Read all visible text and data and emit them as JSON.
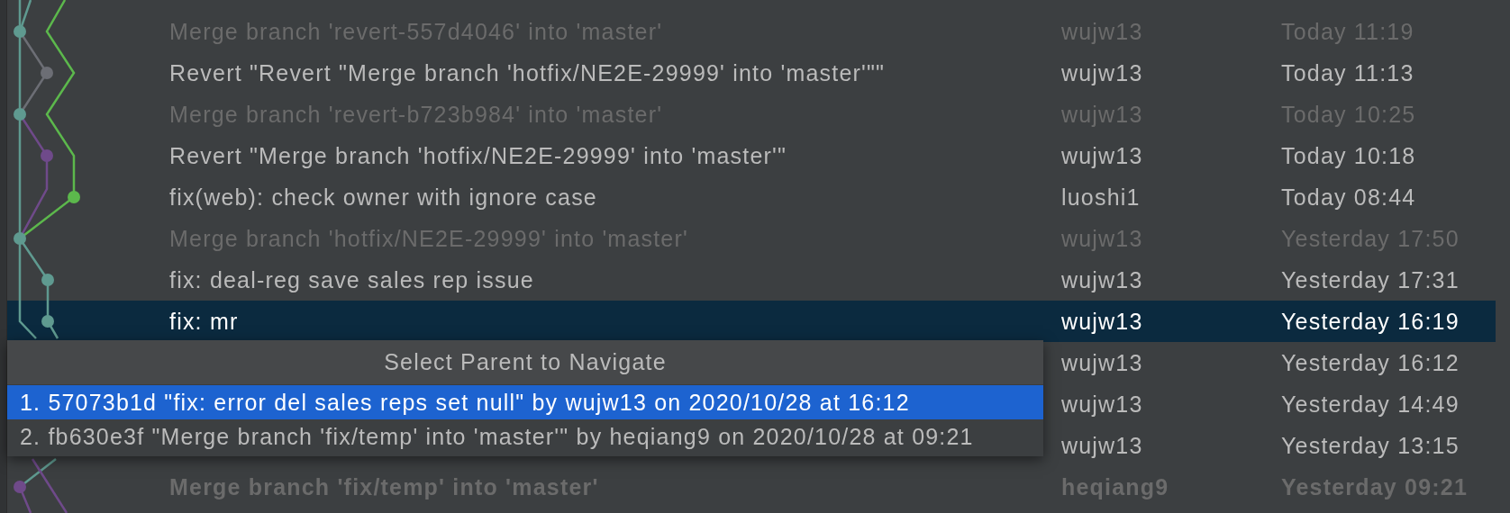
{
  "commits": [
    {
      "message": "Merge branch 'revert-557d4046' into 'master'",
      "author": "wujw13",
      "date": "Today 11:19",
      "dimmed": true,
      "bold": false,
      "selected": false
    },
    {
      "message": "Revert \"Revert \"Merge branch 'hotfix/NE2E-29999' into 'master'\"\"",
      "author": "wujw13",
      "date": "Today 11:13",
      "dimmed": false,
      "bold": false,
      "selected": false
    },
    {
      "message": "Merge branch 'revert-b723b984' into 'master'",
      "author": "wujw13",
      "date": "Today 10:25",
      "dimmed": true,
      "bold": false,
      "selected": false
    },
    {
      "message": "Revert \"Merge branch 'hotfix/NE2E-29999' into 'master'\"",
      "author": "wujw13",
      "date": "Today 10:18",
      "dimmed": false,
      "bold": false,
      "selected": false
    },
    {
      "message": "fix(web): check owner with ignore case",
      "author": "luoshi1",
      "date": "Today 08:44",
      "dimmed": false,
      "bold": false,
      "selected": false
    },
    {
      "message": "Merge branch 'hotfix/NE2E-29999' into 'master'",
      "author": "wujw13",
      "date": "Yesterday 17:50",
      "dimmed": true,
      "bold": false,
      "selected": false
    },
    {
      "message": "fix: deal-reg save sales rep issue",
      "author": "wujw13",
      "date": "Yesterday 17:31",
      "dimmed": false,
      "bold": false,
      "selected": false
    },
    {
      "message": "fix: mr",
      "author": "wujw13",
      "date": "Yesterday 16:19",
      "dimmed": false,
      "bold": false,
      "selected": true
    },
    {
      "author": "wujw13",
      "date": "Yesterday 16:12",
      "dimmed": false,
      "bold": false,
      "selected": false
    },
    {
      "author": "wujw13",
      "date": "Yesterday 14:49",
      "dimmed": false,
      "bold": false,
      "selected": false
    },
    {
      "author": "wujw13",
      "date": "Yesterday 13:15",
      "dimmed": false,
      "bold": false,
      "selected": false
    },
    {
      "message": "Merge branch 'fix/temp' into 'master'",
      "author": "heqiang9",
      "date": "Yesterday 09:21",
      "dimmed": true,
      "bold": true,
      "selected": false
    }
  ],
  "parent_popup": {
    "title": "Select Parent to Navigate",
    "items": [
      {
        "label": "1. 57073b1d \"fix: error del sales reps set null\" by wujw13 on 2020/10/28 at 16:12",
        "selected": true
      },
      {
        "label": "2. fb630e3f \"Merge branch 'fix/temp' into 'master'\" by heqiang9 on 2020/10/28 at 09:21",
        "selected": false
      }
    ]
  }
}
